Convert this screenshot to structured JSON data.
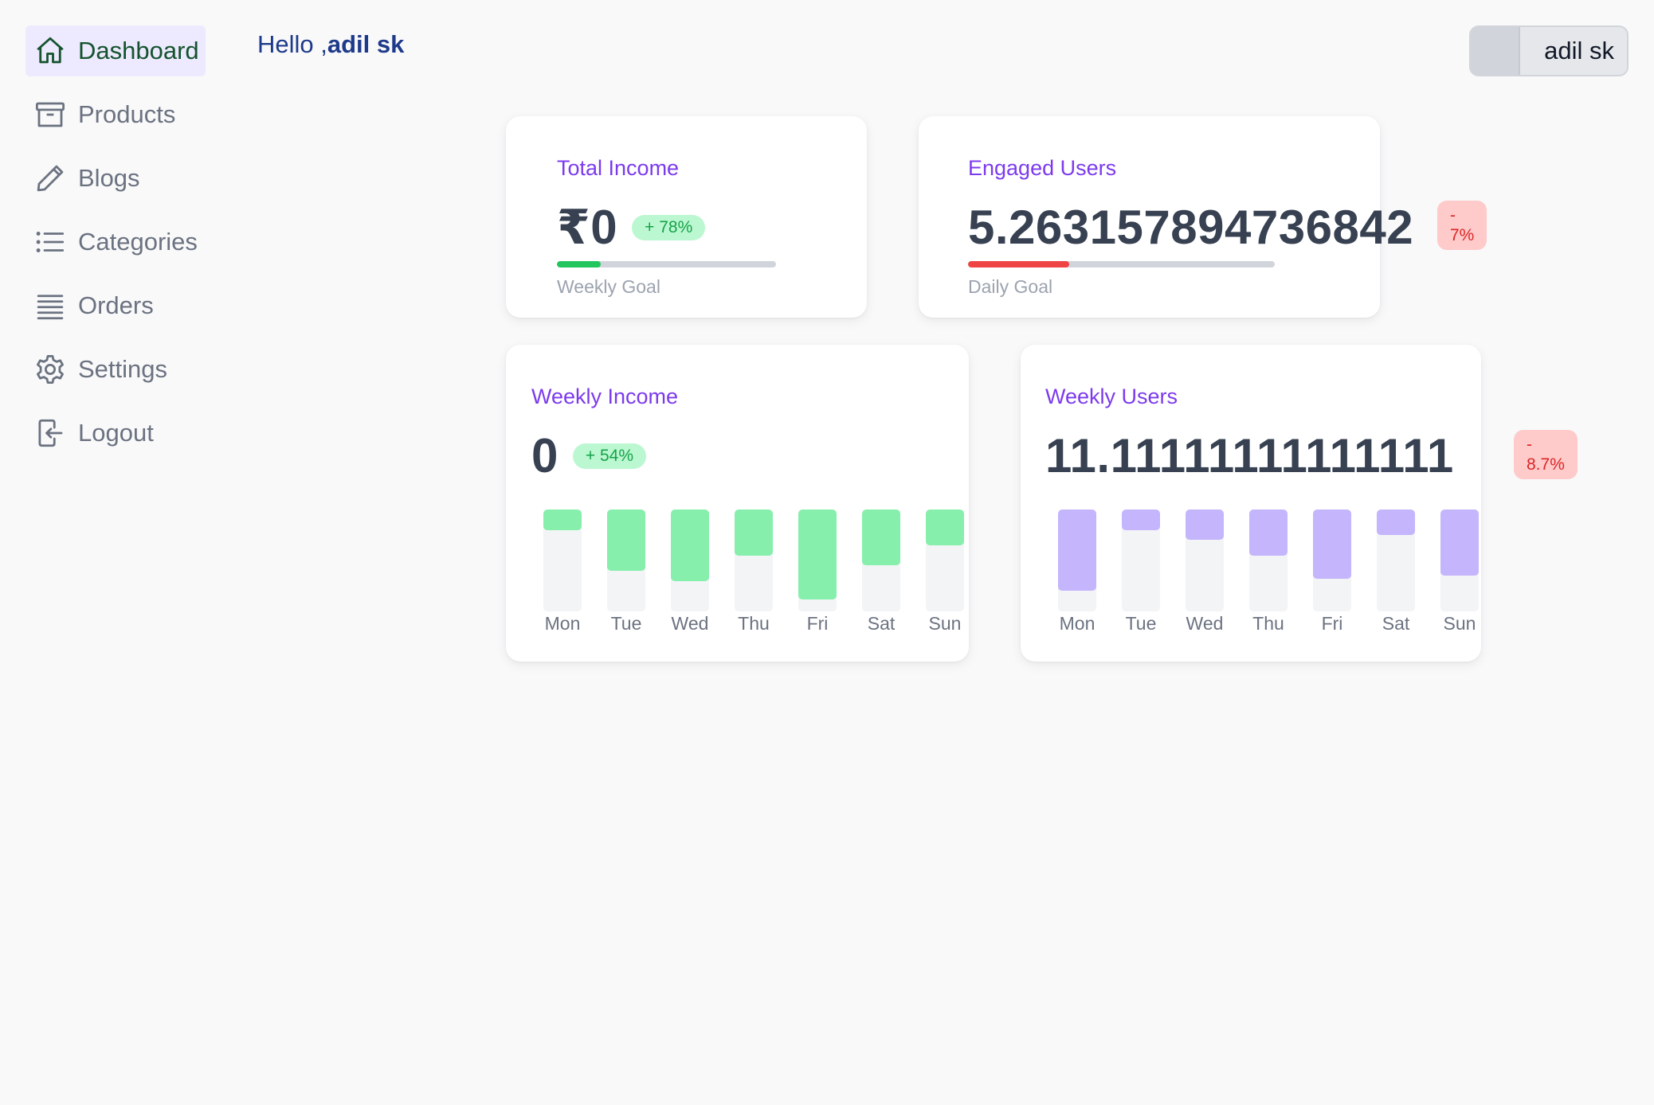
{
  "nav": {
    "items": [
      {
        "label": "Dashboard",
        "icon": "home-icon",
        "active": true
      },
      {
        "label": "Products",
        "icon": "archive-icon"
      },
      {
        "label": "Blogs",
        "icon": "pencil-icon"
      },
      {
        "label": "Categories",
        "icon": "list-icon"
      },
      {
        "label": "Orders",
        "icon": "stack-icon"
      },
      {
        "label": "Settings",
        "icon": "gear-icon"
      },
      {
        "label": "Logout",
        "icon": "logout-icon"
      }
    ]
  },
  "header": {
    "greeting_prefix": "Hello ,",
    "greeting_name": "adil sk",
    "user_name": "adil sk"
  },
  "cards": {
    "total_income": {
      "title": "Total Income",
      "value": "₹0",
      "change": "+ 78%",
      "goal_label": "Weekly Goal",
      "goal_progress": 0.2
    },
    "engaged_users": {
      "title": "Engaged Users",
      "value": "5.263157894736842",
      "change_sign": "-",
      "change_value": "7%",
      "goal_label": "Daily Goal",
      "goal_progress": 0.33
    },
    "weekly_income": {
      "title": "Weekly Income",
      "value": "0",
      "change": "+ 54%"
    },
    "weekly_users": {
      "title": "Weekly Users",
      "value": "11.11111111111111",
      "change_sign": "-",
      "change_value": "8.7%"
    }
  },
  "colors": {
    "accent": "#7c3aed",
    "income_bar": "#86efac",
    "users_bar": "#c4b5fd",
    "progress_up": "#22c55e",
    "progress_down": "#ef4444"
  },
  "chart_data": [
    {
      "type": "bar",
      "categories": [
        "Mon",
        "Tue",
        "Wed",
        "Thu",
        "Fri",
        "Sat",
        "Sun"
      ],
      "values": [
        0.2,
        0.6,
        0.7,
        0.45,
        0.88,
        0.55,
        0.35
      ],
      "ylim": [
        0,
        1
      ]
    },
    {
      "type": "bar",
      "categories": [
        "Mon",
        "Tue",
        "Wed",
        "Thu",
        "Fri",
        "Sat",
        "Sun"
      ],
      "values": [
        0.8,
        0.2,
        0.3,
        0.45,
        0.68,
        0.25,
        0.65
      ],
      "ylim": [
        0,
        1
      ]
    }
  ]
}
